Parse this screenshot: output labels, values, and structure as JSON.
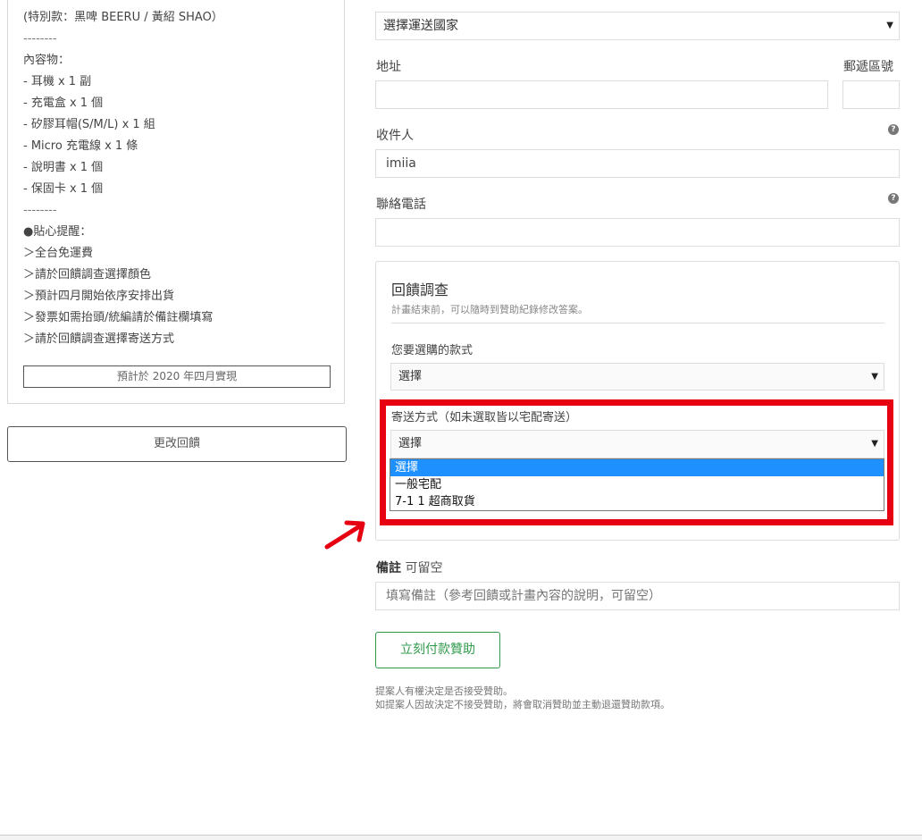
{
  "reward": {
    "lines": [
      "(特別款：黑啤 BEERU / 黃紹 SHAO）",
      "--------",
      "內容物：",
      "- 耳機 x 1 副",
      "- 充電盒 x 1 個",
      "- 矽膠耳帽(S/M/L) x 1 組",
      "- Micro 充電線 x 1 條",
      "- 說明書 x 1 個",
      "- 保固卡 x 1 個",
      "--------",
      "●貼心提醒：",
      "＞全台免運費",
      "＞請於回饋調查選擇顏色",
      "＞預計四月開始依序安排出貨",
      "＞發票如需抬頭/統編請於備註欄填寫",
      "＞請於回饋調查選擇寄送方式"
    ],
    "eta": "預計於 2020 年四月實現",
    "change_button": "更改回饋"
  },
  "form": {
    "country_select": "選擇運送國家",
    "address_label": "地址",
    "postal_label": "郵遞區號",
    "recipient_label": "收件人",
    "recipient_value": "imiia",
    "phone_label": "聯絡電話",
    "help_glyph": "?",
    "survey": {
      "title": "回饋調查",
      "subtitle": "計畫結束前，可以隨時到贊助紀錄修改答案。",
      "style_label": "您要選購的款式",
      "style_value": "選擇",
      "shipping_label": "寄送方式（如未選取皆以宅配寄送）",
      "shipping_value": "選擇",
      "shipping_options": [
        "選擇",
        "一般宅配",
        "7-1 1 超商取貨"
      ]
    },
    "notes_label": "備註",
    "notes_hint": "可留空",
    "notes_placeholder": "填寫備註（參考回饋或計畫內容的說明，可留空）",
    "pay_button": "立刻付款贊助",
    "disclaimer_lines": [
      "提案人有權決定是否接受贊助。",
      "如提案人因故決定不接受贊助，將會取消贊助並主動退還贊助款項。"
    ]
  },
  "colors": {
    "highlight": "#e60012",
    "selected_option": "#1e90ff",
    "pay_green": "#2e9a4a"
  }
}
